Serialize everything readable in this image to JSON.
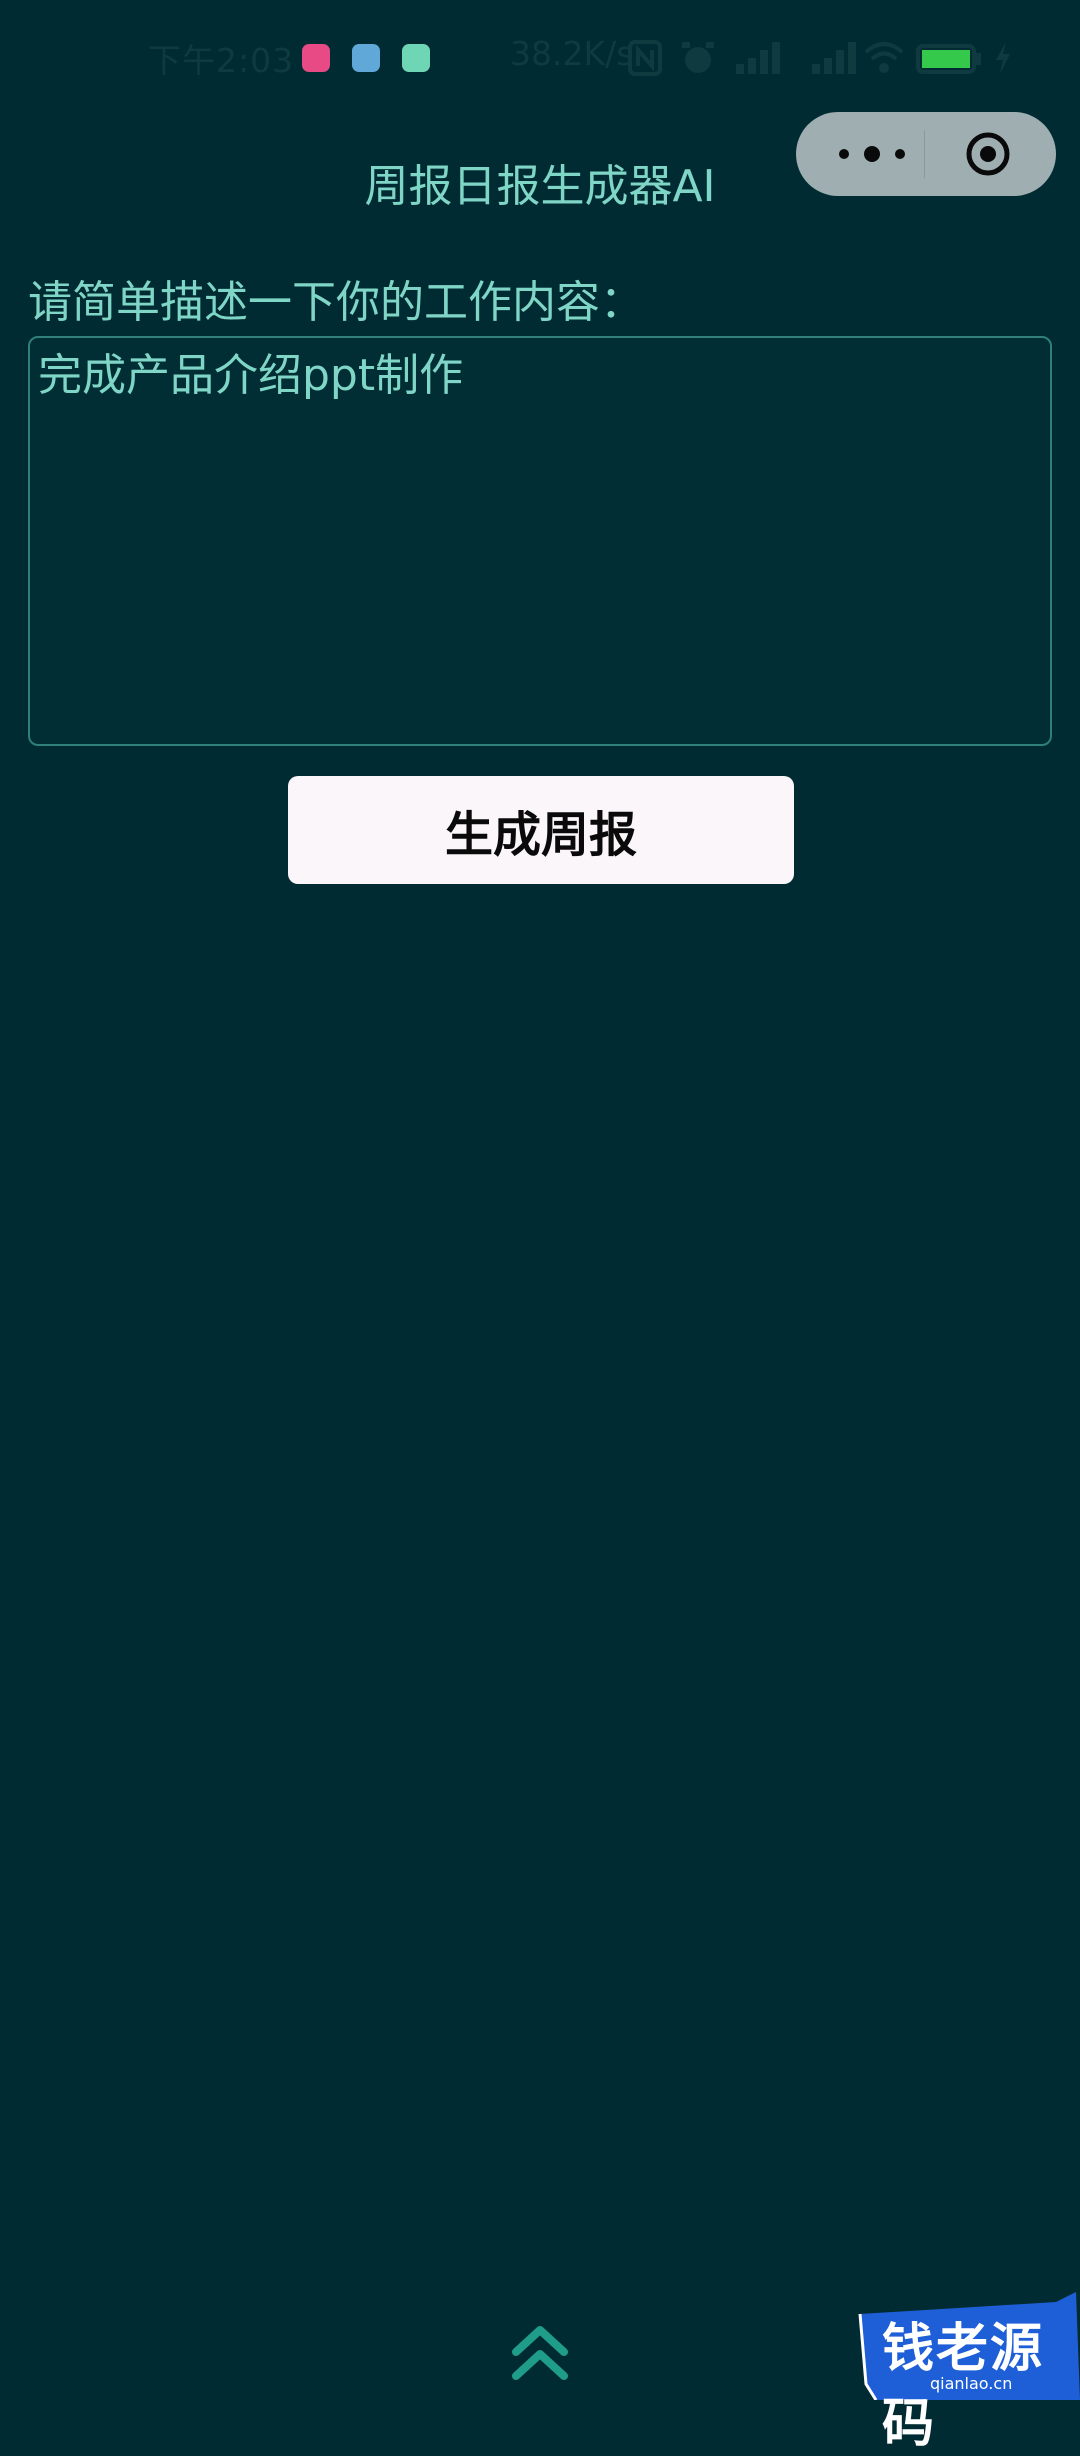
{
  "status_bar": {
    "time": "下午2:03",
    "net_speed": "38.2K/s",
    "apps": [
      {
        "icon": "app-icon-pink",
        "color": "#e84a86"
      },
      {
        "icon": "chat-icon",
        "color": "#5fa8d8"
      },
      {
        "icon": "app-icon-green",
        "color": "#6fd6b5"
      }
    ],
    "status_icons": [
      "nfc-icon",
      "alarm-icon",
      "signal-icon",
      "signal-icon",
      "wifi-icon",
      "battery-icon",
      "charging-icon"
    ],
    "battery_color": "#34c94b"
  },
  "capsule": {
    "menu_icon": "more-dots-icon",
    "close_icon": "target-icon"
  },
  "header": {
    "title": "周报日报生成器AI"
  },
  "form": {
    "prompt_label": "请简单描述一下你的工作内容：",
    "input_value": "完成产品介绍ppt制作",
    "submit_label": "生成周报"
  },
  "footer": {
    "scroll_icon": "double-chevron-up-icon"
  },
  "watermark": {
    "text": "钱老源码",
    "sub": "qianlao.cn"
  },
  "colors": {
    "background": "#012b33",
    "accent_text": "#7fd6c6",
    "button_bg": "#faf6fa"
  }
}
